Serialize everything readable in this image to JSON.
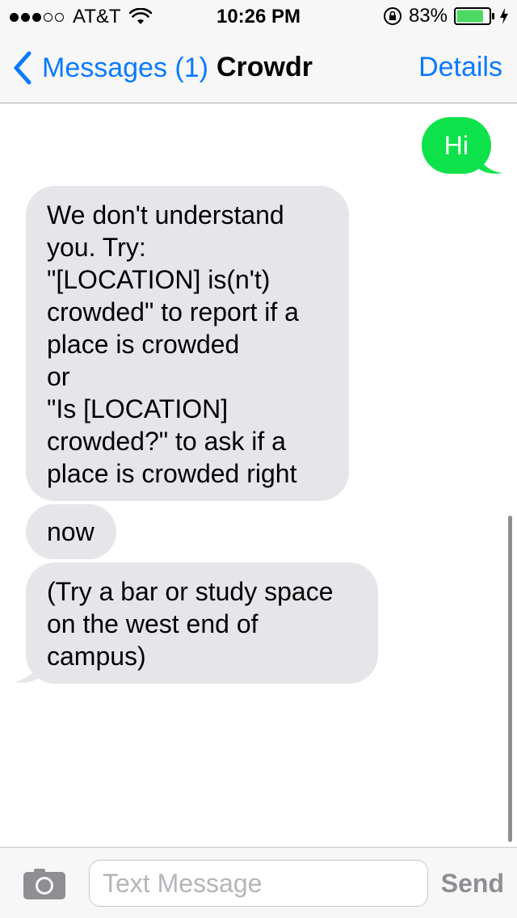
{
  "status_bar": {
    "carrier": "AT&T",
    "signal_bars_filled": 3,
    "signal_bars_total": 5,
    "time": "10:26 PM",
    "battery_percent": "83%",
    "battery_level": 0.83,
    "icons": [
      "wifi-icon",
      "rotation-lock-icon",
      "battery-icon",
      "charging-bolt-icon"
    ]
  },
  "nav": {
    "back_label": "Messages (1)",
    "title": "Crowdr",
    "details_label": "Details"
  },
  "messages": [
    {
      "direction": "outgoing",
      "lines": [
        "Hi"
      ]
    },
    {
      "direction": "incoming",
      "lines": [
        "We don't understand",
        "you. Try:",
        "\"[LOCATION] is(n't)",
        "crowded\" to report if a",
        "place is crowded",
        "or",
        "\"Is [LOCATION]",
        "crowded?\" to ask if a",
        "place is crowded right"
      ]
    },
    {
      "direction": "incoming",
      "lines": [
        "now"
      ]
    },
    {
      "direction": "incoming",
      "lines": [
        "(Try a bar or study space",
        "on the west end of",
        "campus)"
      ]
    }
  ],
  "input": {
    "placeholder": "Text Message",
    "value": "",
    "send_label": "Send"
  },
  "colors": {
    "accent": "#0a7aff",
    "outgoing_bubble": "#0ee24a",
    "incoming_bubble": "#e5e5ea",
    "battery_fill": "#4cd964"
  }
}
